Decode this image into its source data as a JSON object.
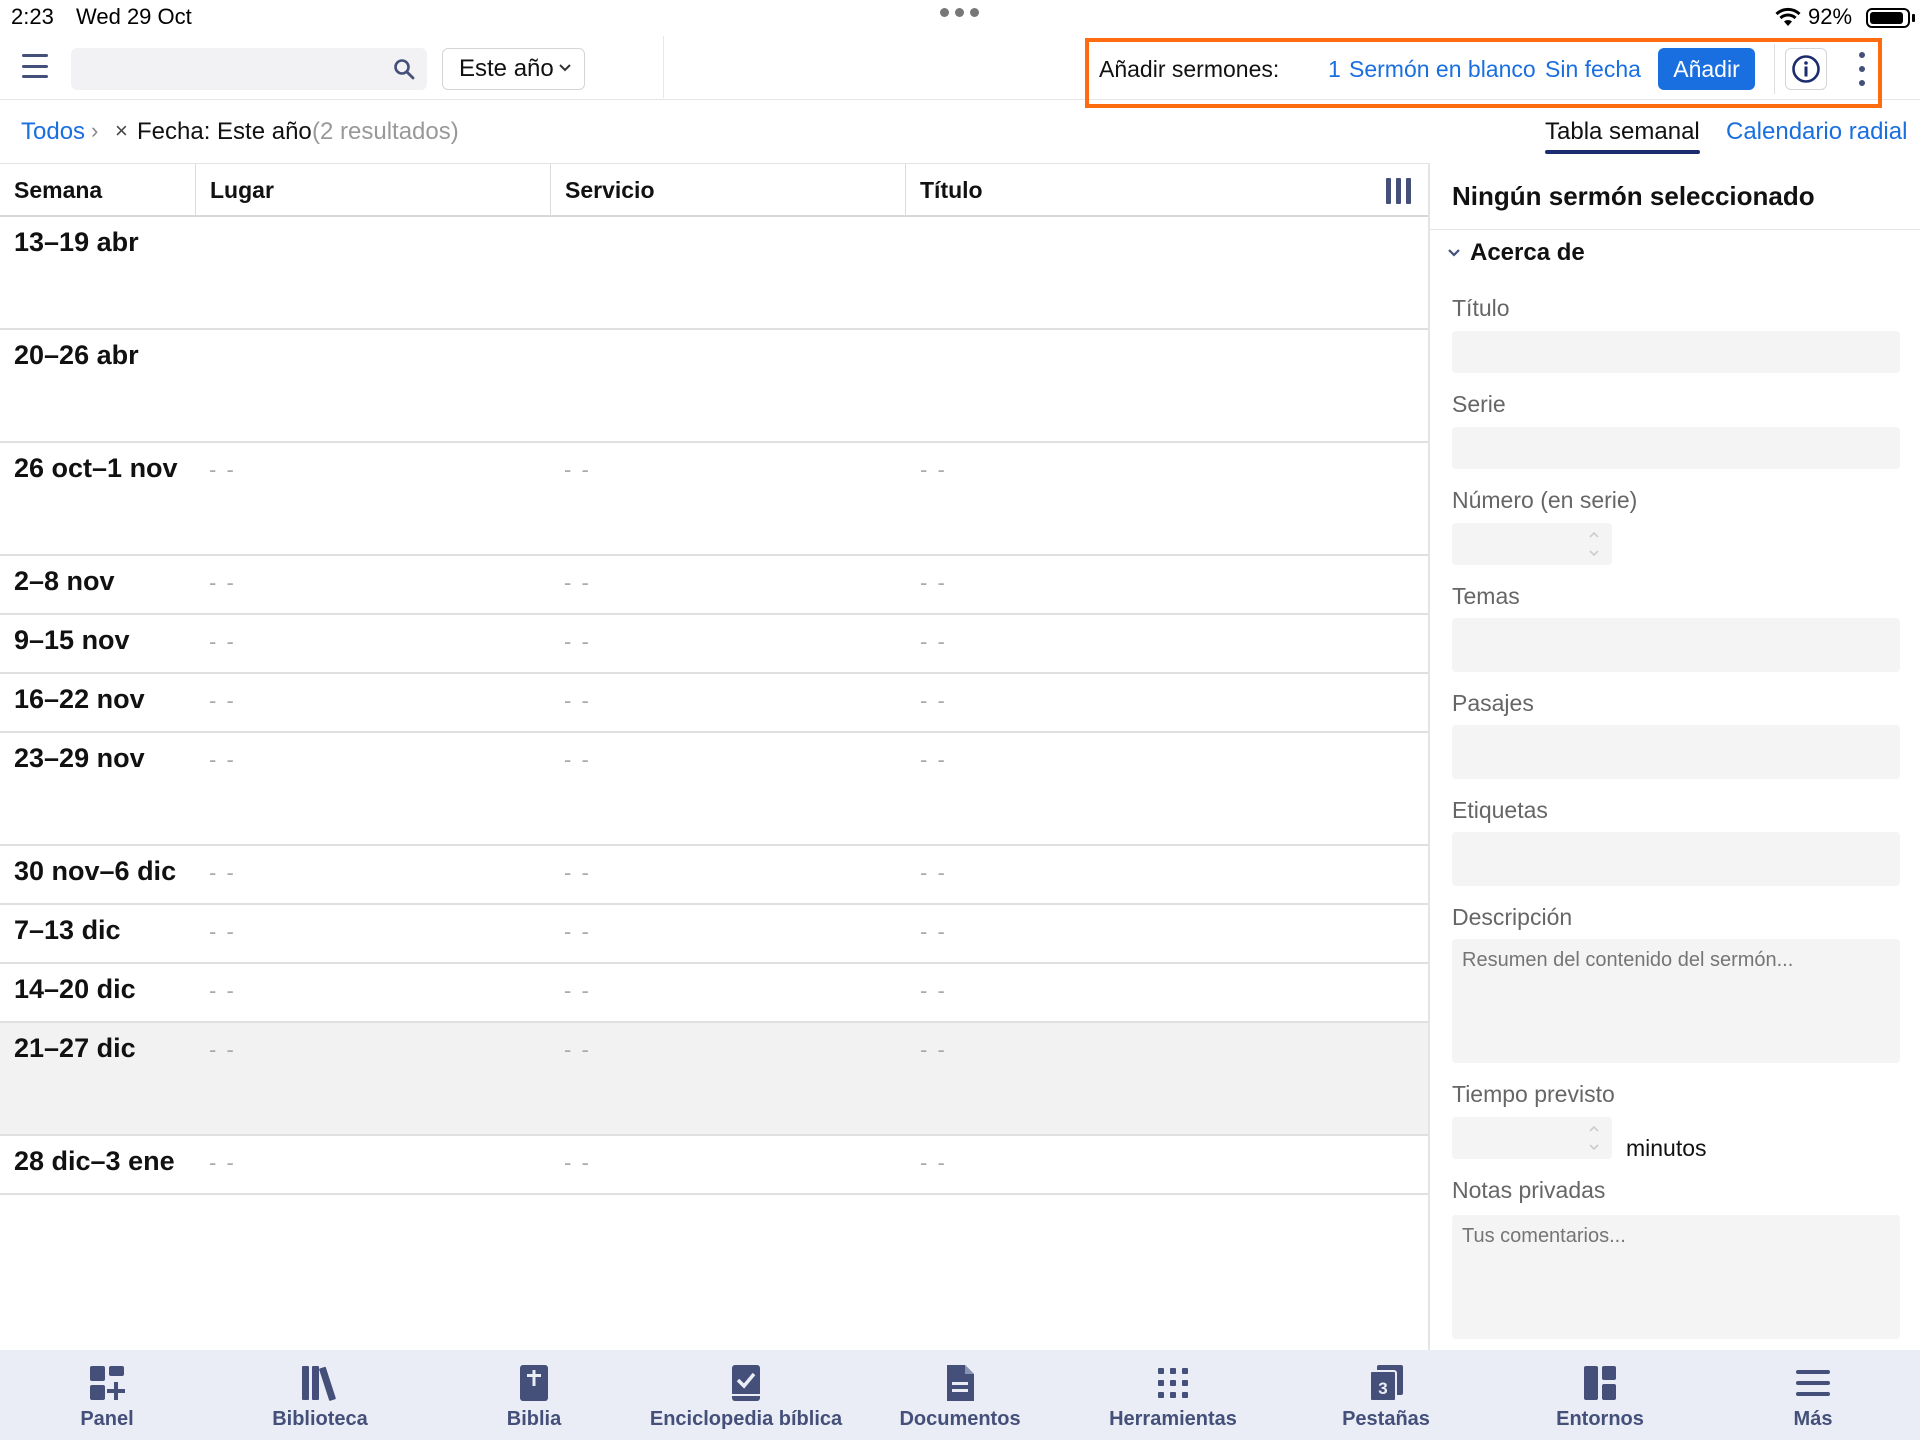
{
  "status_bar": {
    "time": "2:23",
    "date": "Wed 29 Oct",
    "battery": "92%",
    "battery_level": 0.92
  },
  "toolbar": {
    "search_placeholder": "",
    "search_value": "",
    "year_filter": "Este año",
    "add_label": "Añadir sermones:",
    "add_count_link": "1",
    "add_blank_link": "Sermón en blanco",
    "add_nodate_link": "Sin fecha",
    "add_button": "Añadir"
  },
  "breadcrumb": {
    "all": "Todos",
    "separator": "›",
    "remove": "×",
    "filter": "Fecha: Este año",
    "count": "(2 resultados)"
  },
  "view_tabs": [
    "Tabla semanal",
    "Calendario radial"
  ],
  "table": {
    "columns": [
      "Semana",
      "Lugar",
      "Servicio",
      "Título"
    ],
    "empty": "- -",
    "rows": [
      {
        "week": "13–19 abr",
        "empty_cells": false
      },
      {
        "week": "20–26 abr",
        "empty_cells": false
      },
      {
        "week": "26 oct–1 nov",
        "empty_cells": true
      },
      {
        "week": "2–8 nov",
        "empty_cells": true
      },
      {
        "week": "9–15 nov",
        "empty_cells": true
      },
      {
        "week": "16–22 nov",
        "empty_cells": true
      },
      {
        "week": "23–29 nov",
        "empty_cells": true
      },
      {
        "week": "30 nov–6 dic",
        "empty_cells": true
      },
      {
        "week": "7–13 dic",
        "empty_cells": true
      },
      {
        "week": "14–20 dic",
        "empty_cells": true
      },
      {
        "week": "21–27 dic",
        "empty_cells": true,
        "selected": true
      },
      {
        "week": "28 dic–3 ene",
        "empty_cells": true
      }
    ]
  },
  "panel": {
    "title": "Ningún sermón seleccionado",
    "section": "Acerca de",
    "fields": {
      "titulo": "Título",
      "serie": "Serie",
      "numero": "Número (en serie)",
      "temas": "Temas",
      "pasajes": "Pasajes",
      "etiquetas": "Etiquetas",
      "descripcion": "Descripción",
      "descripcion_placeholder": "Resumen del contenido del sermón...",
      "tiempo": "Tiempo previsto",
      "minutos": "minutos",
      "notas": "Notas privadas",
      "notas_placeholder": "Tus comentarios..."
    }
  },
  "tabbar": [
    {
      "label": "Panel",
      "icon": "panel-icon"
    },
    {
      "label": "Biblioteca",
      "icon": "library-icon"
    },
    {
      "label": "Biblia",
      "icon": "bible-icon"
    },
    {
      "label": "Enciclopedia bíblica",
      "icon": "encyclopedia-icon"
    },
    {
      "label": "Documentos",
      "icon": "documents-icon"
    },
    {
      "label": "Herramientas",
      "icon": "tools-grid-icon"
    },
    {
      "label": "Pestañas",
      "icon": "tabs-icon",
      "badge": "3"
    },
    {
      "label": "Entornos",
      "icon": "layouts-icon"
    },
    {
      "label": "Más",
      "icon": "more-menu-icon"
    }
  ],
  "colors": {
    "accent": "#1a6fe0",
    "highlight_box": "#ff6b0f",
    "icon": "#44507a",
    "tabbar_bg": "#eaedf5"
  }
}
